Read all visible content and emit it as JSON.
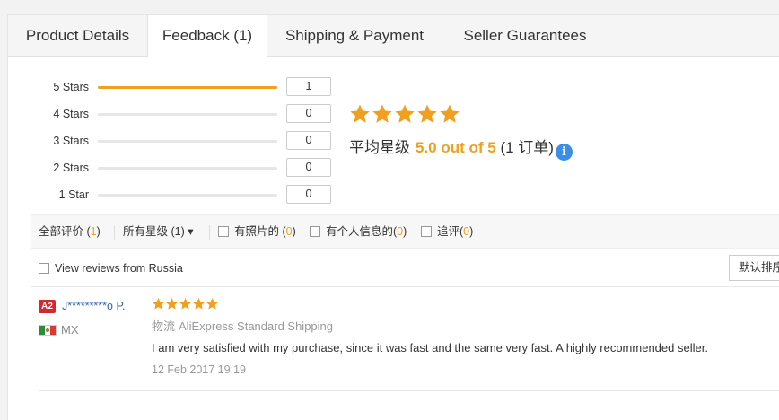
{
  "tabs": [
    {
      "label": "Product Details",
      "active": false
    },
    {
      "label": "Feedback (1)",
      "active": true
    },
    {
      "label": "Shipping & Payment",
      "active": false
    },
    {
      "label": "Seller Guarantees",
      "active": false
    }
  ],
  "rating_summary": {
    "rows": [
      {
        "label": "5 Stars",
        "count": "1",
        "fraction": 1.0
      },
      {
        "label": "4 Stars",
        "count": "0",
        "fraction": 0
      },
      {
        "label": "3 Stars",
        "count": "0",
        "fraction": 0
      },
      {
        "label": "2 Stars",
        "count": "0",
        "fraction": 0
      },
      {
        "label": "1 Star",
        "count": "0",
        "fraction": 0
      }
    ],
    "stars_filled": 5,
    "avg_label": "平均星级",
    "avg_value": "5.0 out of 5",
    "order_text": "(1 订单)",
    "info_icon": "i"
  },
  "filters": {
    "all": {
      "label": "全部评价 (",
      "count": "1",
      "close": ")"
    },
    "stars": {
      "label": "所有星级 (1)",
      "arrow": "▾"
    },
    "photos": {
      "label": "有照片的 (",
      "count": "0",
      "close": ")"
    },
    "personal": {
      "label": "有个人信息的(",
      "count": "0",
      "close": ")"
    },
    "followup": {
      "label": "追评(",
      "count": "0",
      "close": ")"
    }
  },
  "russia_filter": {
    "label": "View reviews from Russia",
    "checked": false
  },
  "sort_button": {
    "label": "默认排序"
  },
  "review": {
    "badge": "A2",
    "user": "J*********o P.",
    "country": "MX",
    "stars": 5,
    "shipping_label": "物流",
    "shipping_method": "AliExpress Standard Shipping",
    "text": "I am very satisfied with my purchase, since it was fast and the same very fast. A highly recommended seller.",
    "date": "12 Feb 2017 19:19"
  },
  "colors": {
    "accent_orange": "#f0a01e",
    "link_blue": "#2f66b4",
    "info_blue": "#3a8ee6",
    "badge_red": "#d7262c"
  },
  "icons": {
    "star": "star-icon",
    "info": "info-icon",
    "dropdown": "chevron-down-icon",
    "flag": "mexico-flag-icon"
  }
}
